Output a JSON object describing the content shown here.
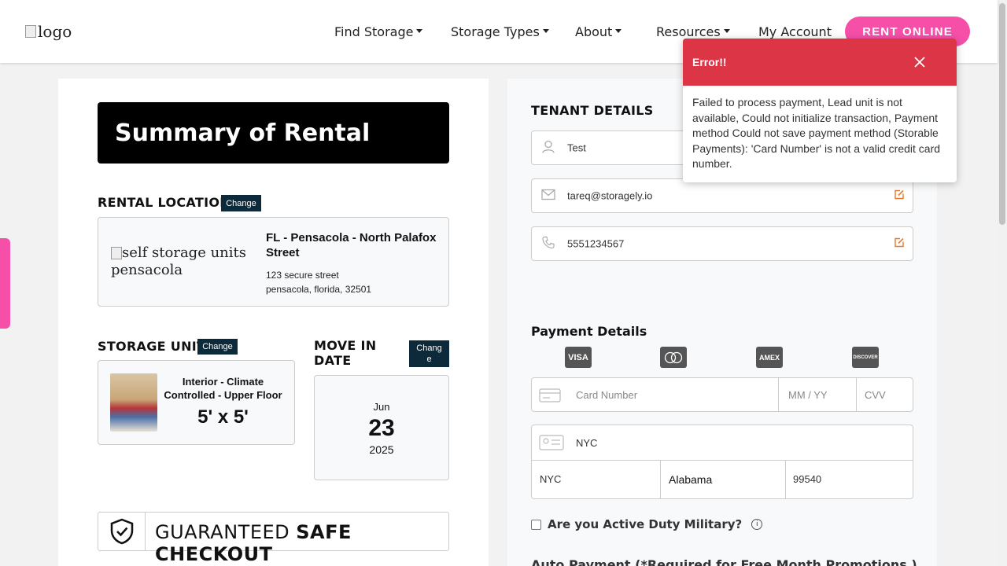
{
  "header": {
    "logo_alt": "logo",
    "nav": [
      {
        "label": "Find Storage",
        "has_caret": true
      },
      {
        "label": "Storage Types",
        "has_caret": true
      },
      {
        "label": "About",
        "has_caret": true
      },
      {
        "label": "Resources",
        "has_caret": true
      },
      {
        "label": "My Account",
        "has_caret": false
      }
    ],
    "cta_label": "RENT ONLINE"
  },
  "summary": {
    "title": "Summary of Rental",
    "rental_location_label": "RENTAL LOCATION",
    "change_label": "Change",
    "location": {
      "image_alt": "self storage units pensacola",
      "name": "FL - Pensacola - North Palafox Street",
      "address_line1": "123 secure street",
      "address_line2": "pensacola, florida, 32501"
    },
    "storage_unit_label": "STORAGE UNIT",
    "unit": {
      "name": "Interior - Climate Controlled - Upper Floor",
      "size": "5' x 5'"
    },
    "move_in_label": "MOVE IN DATE",
    "move_in_change_label": "Change",
    "move_in": {
      "month": "Jun",
      "day": "23",
      "year": "2025"
    },
    "safe_checkout_prefix": "GUARANTEED",
    "safe_checkout_bold": "SAFE CHECKOUT"
  },
  "tenant": {
    "title": "TENANT DETAILS",
    "name": "Test",
    "email": "tareq@storagely.io",
    "phone": "5551234567"
  },
  "payment": {
    "title": "Payment Details",
    "card_brands": [
      "VISA",
      "mastercard",
      "AMEX",
      "DISCOVER"
    ],
    "card_number_placeholder": "Card Number",
    "expiry_placeholder": "MM / YY",
    "cvv_placeholder": "CVV",
    "address": "NYC",
    "city": "NYC",
    "state": "Alabama",
    "zip": "99540",
    "military_label": "Are you Active Duty Military?",
    "auto_payment_label": "Auto Payment (*Required for Free Month Promotions )"
  },
  "toast": {
    "title": "Error!!",
    "message": "Failed to process payment, Lead unit is not available, Could not initialize transaction, Payment method Could not save payment method (Storable Payments): 'Card Number' is not a valid credit card number."
  },
  "colors": {
    "brand_pink": "#f54fa8",
    "error_red": "#dc3545",
    "dark_navy": "#0d2a3b",
    "edit_orange": "#e8792c"
  }
}
